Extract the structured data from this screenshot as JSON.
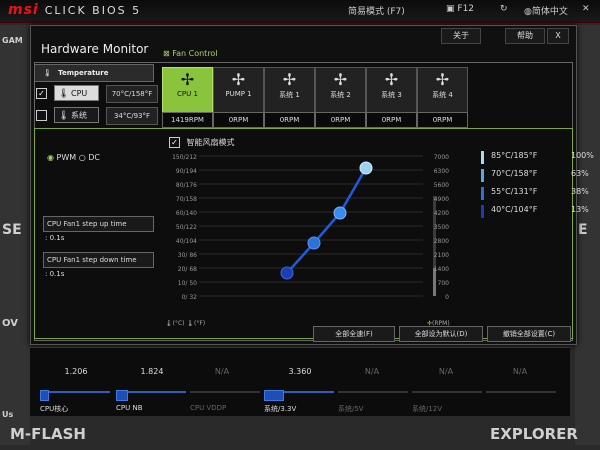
{
  "topbar": {
    "brand": "msi",
    "product": "CLICK BIOS 5",
    "mode": "简易模式 (F7)",
    "f12": "F12",
    "lang": "简体中文"
  },
  "background": {
    "left_labels": [
      "GAM",
      "SE",
      "OV",
      "Us"
    ],
    "right_labels": [
      "E"
    ],
    "mflash": "M-FLASH",
    "explorer": "EXPLORER"
  },
  "window": {
    "title": "Hardware Monitor",
    "buttons": {
      "about": "关于",
      "help": "帮助",
      "close": "X"
    },
    "temperature": {
      "header": "Temperature",
      "sensors": [
        {
          "name": "CPU",
          "value": "70°C/158°F",
          "checked": true,
          "selected": true
        },
        {
          "name": "系统",
          "value": "34°C/93°F",
          "checked": false,
          "selected": false
        }
      ]
    },
    "fan_control_label": "Fan Control",
    "fans": [
      {
        "name": "CPU 1",
        "rpm": "1419RPM"
      },
      {
        "name": "PUMP 1",
        "rpm": "0RPM"
      },
      {
        "name": "系统 1",
        "rpm": "0RPM"
      },
      {
        "name": "系统 2",
        "rpm": "0RPM"
      },
      {
        "name": "系统 3",
        "rpm": "0RPM"
      },
      {
        "name": "系统 4",
        "rpm": "0RPM"
      }
    ],
    "mode": {
      "pwm": "PWM",
      "dc": "DC"
    },
    "step_up": {
      "label": "CPU Fan1 step up time",
      "value": ": 0.1s"
    },
    "step_down": {
      "label": "CPU Fan1 step down time",
      "value": ": 0.1s"
    },
    "smart_fan": "智能风扇模式",
    "chart": {
      "left_ticks": [
        "150/212",
        "90/194",
        "80/176",
        "70/158",
        "60/140",
        "50/122",
        "40/104",
        "30/ 86",
        "20/ 68",
        "10/ 50",
        "0/ 32"
      ],
      "right_ticks": [
        "7000",
        "6300",
        "5600",
        "4900",
        "4200",
        "3500",
        "2800",
        "2100",
        "1400",
        "700",
        "0"
      ],
      "unit_temp_c": "(°C)",
      "unit_temp_f": "(°F)",
      "unit_rpm": "(RPM)",
      "legend": [
        {
          "temp": "85°C/185°F",
          "pct": "100%",
          "color": "#a9d8f0"
        },
        {
          "temp": "70°C/158°F",
          "pct": "63%",
          "color": "#55a8ea"
        },
        {
          "temp": "55°C/131°F",
          "pct": "38%",
          "color": "#2d72d8"
        },
        {
          "temp": "40°C/104°F",
          "pct": "13%",
          "color": "#1b3fb0"
        }
      ]
    },
    "actions": {
      "full_speed": "全部全速(F)",
      "default": "全部设为默认(D)",
      "cancel": "撤销全部设置(C)"
    }
  },
  "voltages": [
    {
      "value": "1.206",
      "label": "CPU核心",
      "fill": 0.1,
      "active": true
    },
    {
      "value": "1.824",
      "label": "CPU NB",
      "fill": 0.15,
      "active": true
    },
    {
      "value": "N/A",
      "label": "CPU VDDP",
      "fill": 0,
      "active": false
    },
    {
      "value": "3.360",
      "label": "系统/3.3V",
      "fill": 0.25,
      "active": true
    },
    {
      "value": "N/A",
      "label": "系统/5V",
      "fill": 0,
      "active": false
    },
    {
      "value": "N/A",
      "label": "系统/12V",
      "fill": 0,
      "active": false
    },
    {
      "value": "N/A",
      "label": "",
      "fill": 0,
      "active": false
    }
  ]
}
